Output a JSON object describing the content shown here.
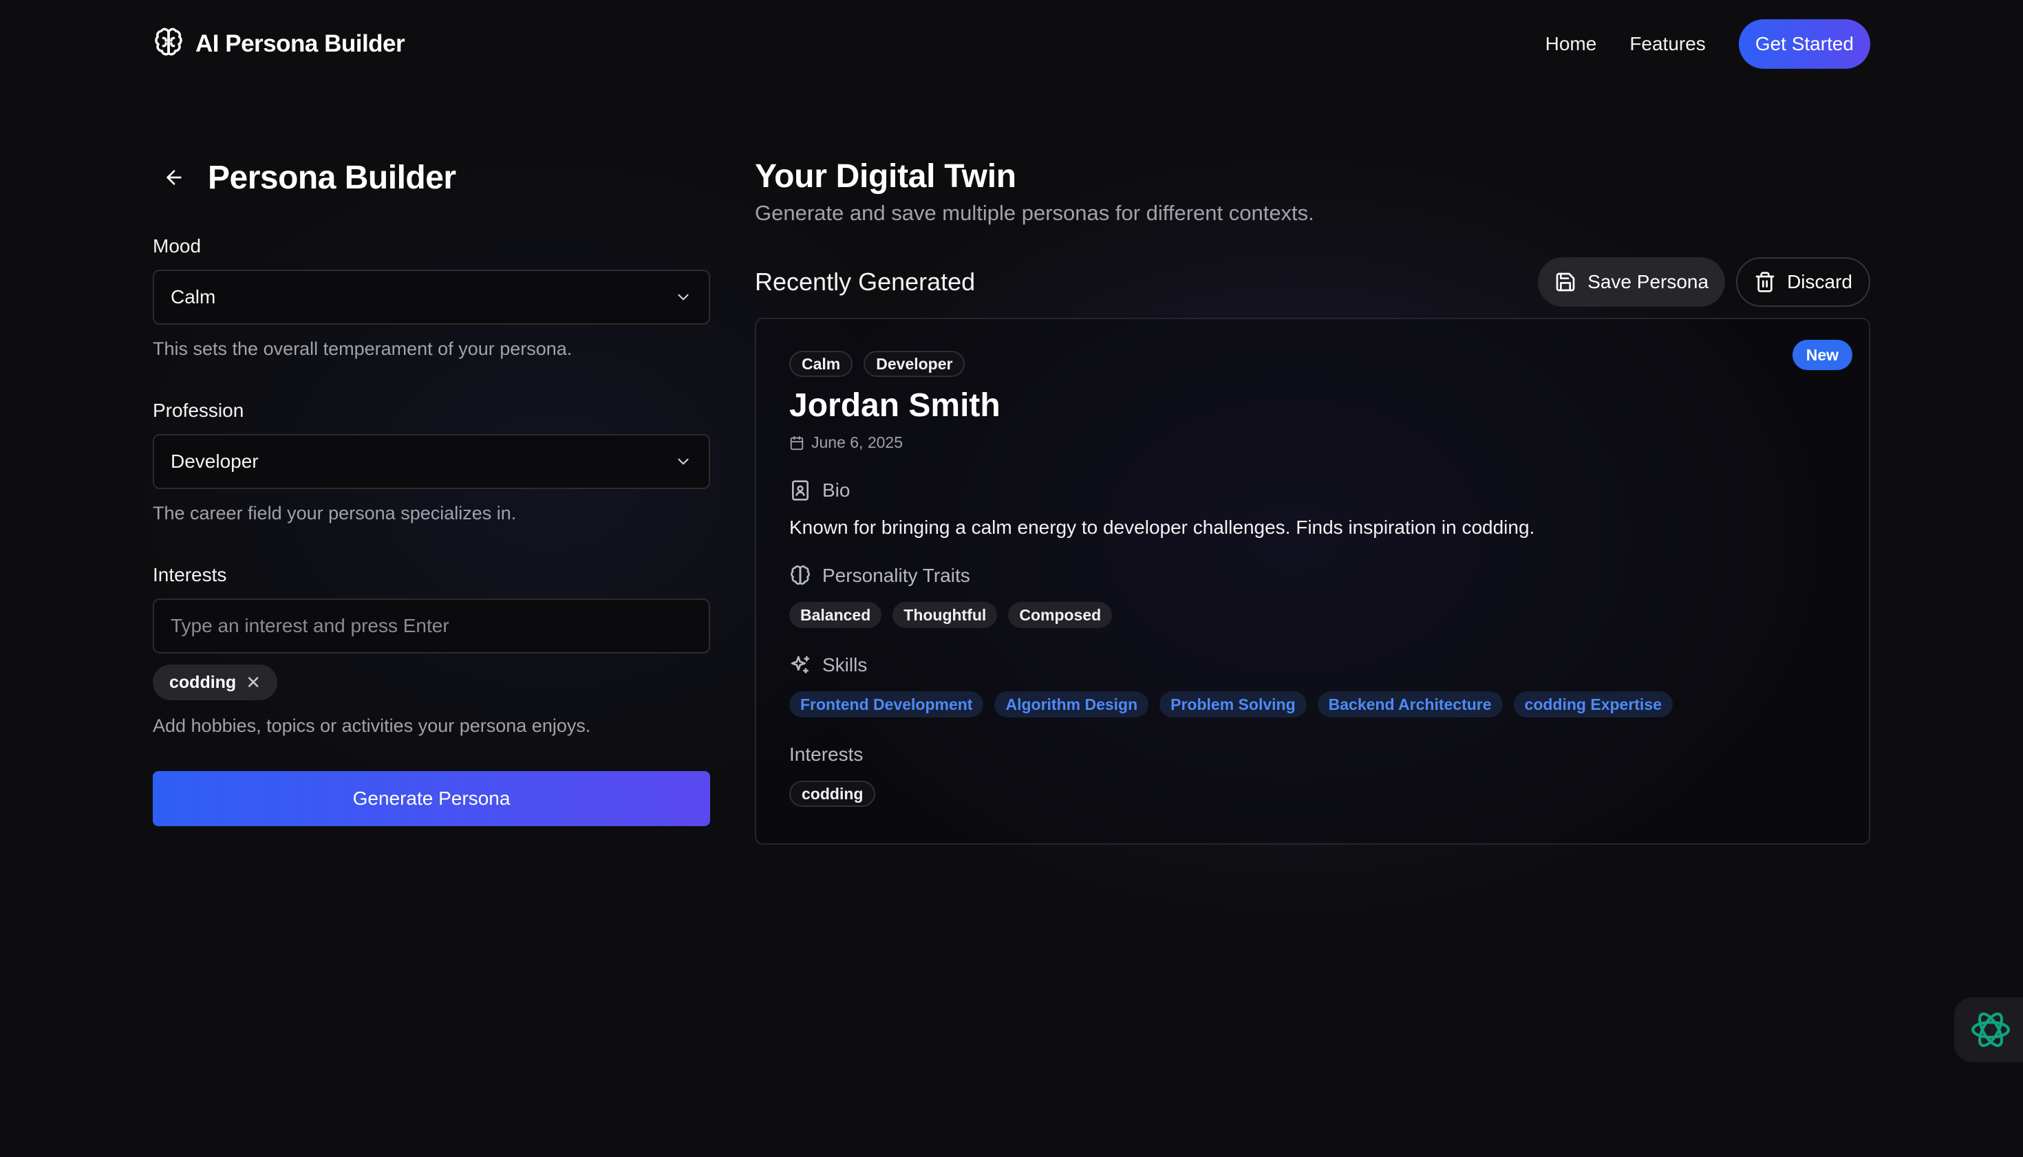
{
  "header": {
    "brand": "AI Persona Builder",
    "nav": {
      "home": "Home",
      "features": "Features"
    },
    "cta": "Get Started"
  },
  "builder": {
    "title": "Persona Builder",
    "mood": {
      "label": "Mood",
      "value": "Calm",
      "help": "This sets the overall temperament of your persona."
    },
    "profession": {
      "label": "Profession",
      "value": "Developer",
      "help": "The career field your persona specializes in."
    },
    "interests": {
      "label": "Interests",
      "placeholder": "Type an interest and press Enter",
      "chips": [
        "codding"
      ],
      "remove_glyph": "✕",
      "help": "Add hobbies, topics or activities your persona enjoys."
    },
    "generate": "Generate Persona"
  },
  "twin": {
    "title": "Your Digital Twin",
    "subtitle": "Generate and save multiple personas for different contexts.",
    "recent_title": "Recently Generated",
    "save": "Save Persona",
    "discard": "Discard"
  },
  "persona": {
    "badge": "New",
    "tags": [
      "Calm",
      "Developer"
    ],
    "name": "Jordan Smith",
    "date": "June 6, 2025",
    "bio_label": "Bio",
    "bio": "Known for bringing a calm energy to developer challenges. Finds inspiration in codding.",
    "traits_label": "Personality Traits",
    "traits": [
      "Balanced",
      "Thoughtful",
      "Composed"
    ],
    "skills_label": "Skills",
    "skills": [
      "Frontend Development",
      "Algorithm Design",
      "Problem Solving",
      "Backend Architecture",
      "codding Expertise"
    ],
    "interests_label": "Interests",
    "interests": [
      "codding"
    ]
  },
  "colors": {
    "accent_blue": "#2f5ff5",
    "accent_violet": "#5a49ef",
    "skill_text": "#4e8af7",
    "assistant_icon": "#10a37f"
  },
  "icons": {
    "brand": "brain-icon",
    "back": "arrow-left-icon",
    "select": "chevron-down-icon",
    "save": "floppy-disk-icon",
    "discard": "trash-icon",
    "date": "calendar-icon",
    "bio": "contact-book-icon",
    "traits": "brain-icon",
    "skills": "sparkles-icon",
    "assistant": "openai-logo-icon"
  }
}
